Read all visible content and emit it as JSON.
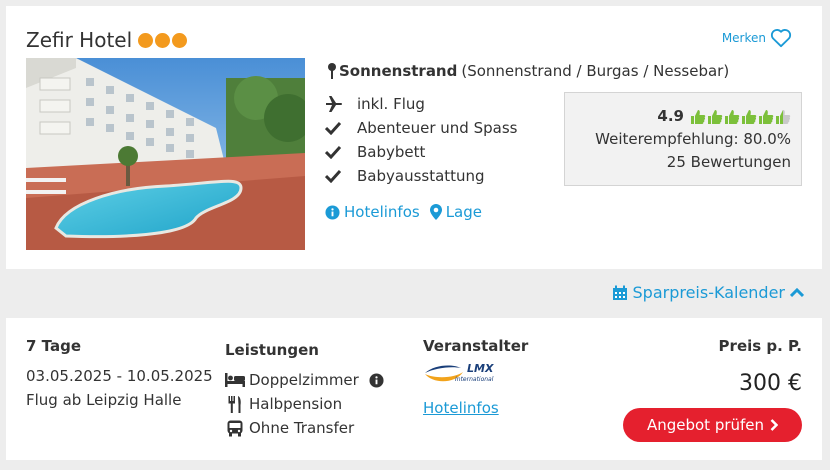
{
  "hotel": {
    "name": "Zefir Hotel",
    "stars": 3,
    "star_color": "#f39a1e",
    "merken_label": "Merken",
    "location_bold": "Sonnenstrand",
    "location_rest": "(Sonnenstrand / Burgas / Nessebar)",
    "features": [
      {
        "icon": "plane-icon",
        "label": "inkl. Flug"
      },
      {
        "icon": "check-icon",
        "label": "Abenteuer und Spass"
      },
      {
        "icon": "check-icon",
        "label": "Babybett"
      },
      {
        "icon": "check-icon",
        "label": "Babyausstattung"
      }
    ],
    "links": {
      "hotelinfos": "Hotelinfos",
      "lage": "Lage"
    },
    "rating": {
      "score": "4.9",
      "thumbs": 5.5,
      "recommendation": "Weiterempfehlung: 80.0%",
      "reviews": "25 Bewertungen"
    }
  },
  "sparpreis_label": "Sparpreis-Kalender",
  "offer": {
    "duration": "7 Tage",
    "dates": "03.05.2025 - 10.05.2025",
    "flight": "Flug ab Leipzig Halle",
    "leistungen_title": "Leistungen",
    "room": "Doppelzimmer",
    "board": "Halbpension",
    "transfer": "Ohne Transfer",
    "veranstalter_title": "Veranstalter",
    "veranstalter_logo_text": "LMX",
    "veranstalter_logo_sub": "International",
    "veranstalter_link": "Hotelinfos",
    "price_title": "Preis p. P.",
    "price": "300 €",
    "cta": "Angebot prüfen"
  },
  "colors": {
    "accent": "#1b9ad6",
    "cta": "#e5202e",
    "thumbs": "#7cc03a"
  }
}
